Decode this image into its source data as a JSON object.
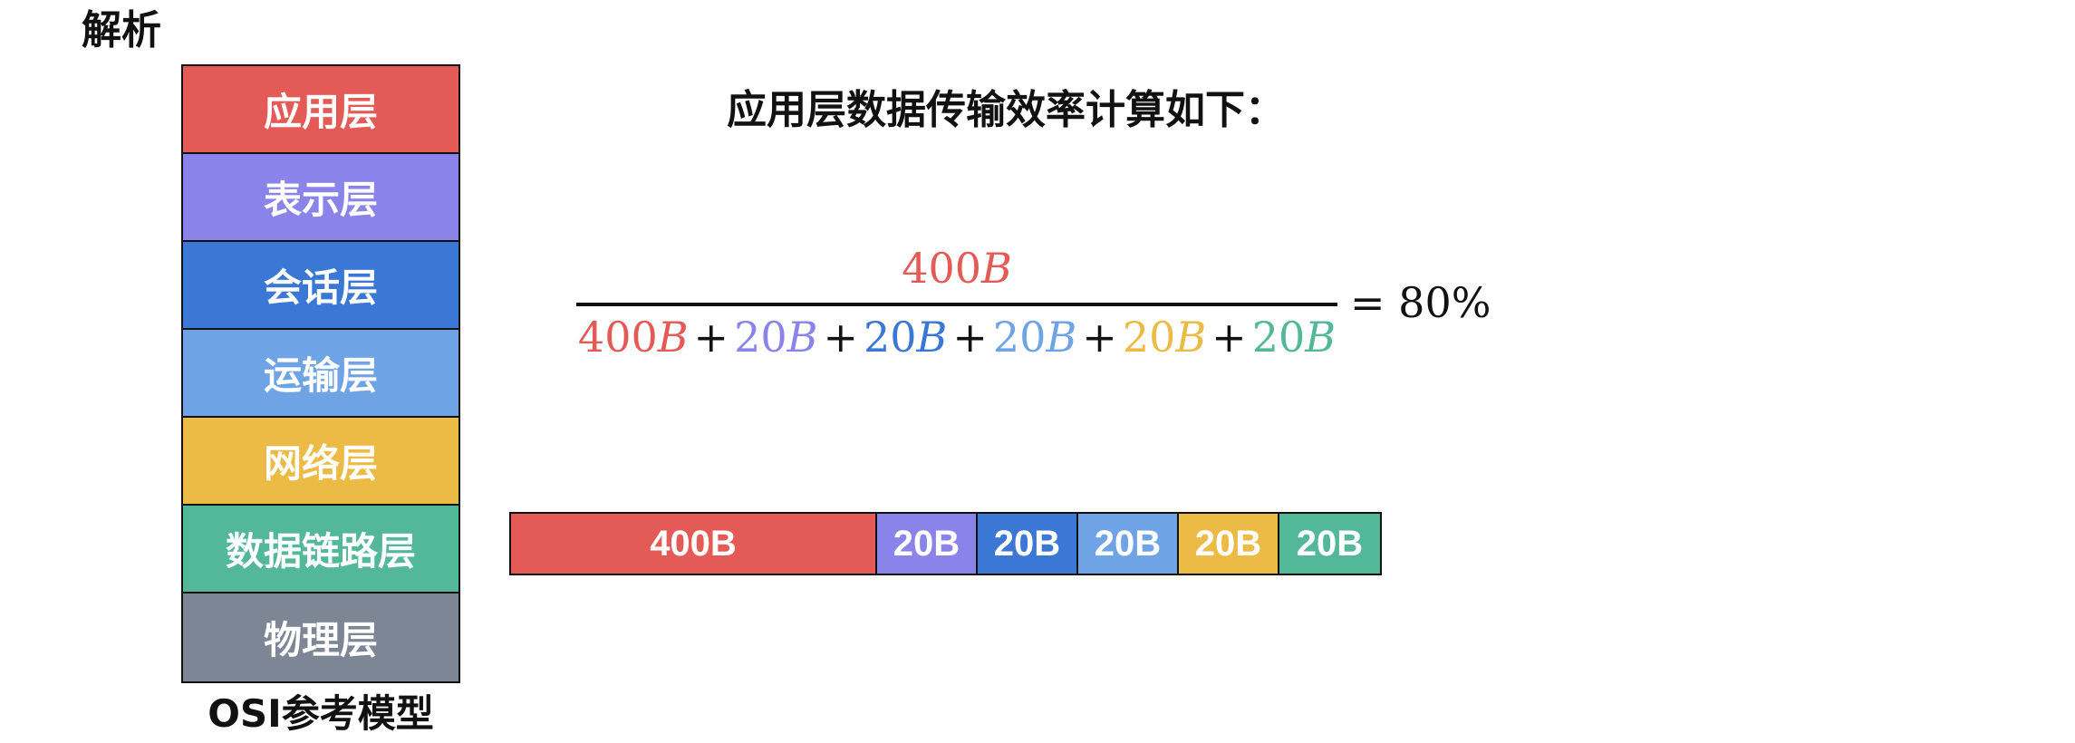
{
  "heading": "解析",
  "colors": {
    "application": "#e45a56",
    "presentation": "#8a84ea",
    "session": "#3b78d6",
    "transport": "#6ea3e6",
    "network": "#ecbb45",
    "datalink": "#52b898",
    "physical": "#7c8694"
  },
  "osi": {
    "layers": [
      {
        "label": "应用层",
        "color": "#e45a56"
      },
      {
        "label": "表示层",
        "color": "#8a84ea"
      },
      {
        "label": "会话层",
        "color": "#3b78d6"
      },
      {
        "label": "运输层",
        "color": "#6ea3e6"
      },
      {
        "label": "网络层",
        "color": "#ecbb45"
      },
      {
        "label": "数据链路层",
        "color": "#52b898"
      },
      {
        "label": "物理层",
        "color": "#7c8694"
      }
    ],
    "caption": "OSI参考模型"
  },
  "formula": {
    "title": "应用层数据传输效率计算如下：",
    "numerator": {
      "value": "400",
      "unit": "B",
      "color": "#e45a56"
    },
    "denominator": [
      {
        "value": "400",
        "unit": "B",
        "color": "#e45a56"
      },
      {
        "value": "20",
        "unit": "B",
        "color": "#8a84ea"
      },
      {
        "value": "20",
        "unit": "B",
        "color": "#3b78d6"
      },
      {
        "value": "20",
        "unit": "B",
        "color": "#6ea3e6"
      },
      {
        "value": "20",
        "unit": "B",
        "color": "#ecbb45"
      },
      {
        "value": "20",
        "unit": "B",
        "color": "#52b898"
      }
    ],
    "operator": "+",
    "equals": "=",
    "result": "80%"
  },
  "packet_bar": {
    "segments": [
      {
        "label": "400B",
        "color": "#e45a56"
      },
      {
        "label": "20B",
        "color": "#8a84ea"
      },
      {
        "label": "20B",
        "color": "#3b78d6"
      },
      {
        "label": "20B",
        "color": "#6ea3e6"
      },
      {
        "label": "20B",
        "color": "#ecbb45"
      },
      {
        "label": "20B",
        "color": "#52b898"
      }
    ]
  }
}
